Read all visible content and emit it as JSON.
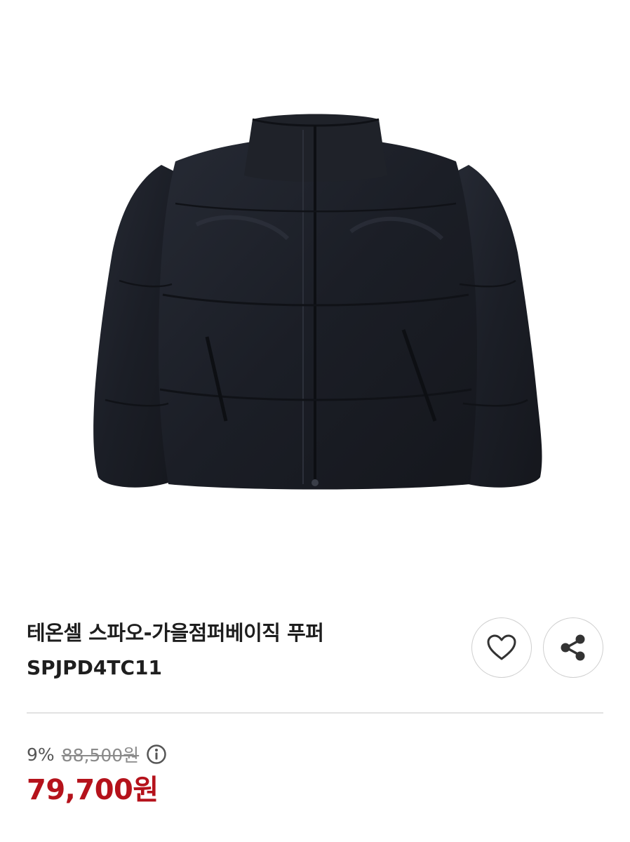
{
  "product": {
    "image_icon": "black-puffer-jacket-photo",
    "title": "테온셀 스파오-가을점퍼베이직 푸퍼",
    "code": "SPJPD4TC11"
  },
  "actions": {
    "like_icon": "heart-icon",
    "share_icon": "share-icon"
  },
  "pricing": {
    "discount": "9%",
    "original_price": "88,500원",
    "info_icon": "info-icon",
    "sale_price": "79,700원"
  },
  "colors": {
    "sale_price": "#b5121b",
    "jacket": "#1b1e26",
    "divider": "#e2e2e2"
  }
}
